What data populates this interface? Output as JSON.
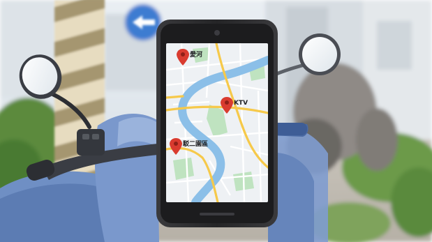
{
  "map": {
    "pins": [
      {
        "label": "愛河"
      },
      {
        "label": "KTV"
      },
      {
        "label": "駁二園區"
      }
    ]
  },
  "colors": {
    "sky": "#dfe7ee",
    "pole_stripe_light": "#e7dcc0",
    "pole_stripe_dark": "#9a8a62",
    "scooter_blue": "#6f8fc4",
    "phone_frame": "#2b2b2d",
    "map_background": "#eef1f4",
    "river": "#8bbfe8",
    "park": "#bfe3c0",
    "major_road": "#f6c94a",
    "pin": "#d93b2f"
  },
  "icons": [
    "map-pin-icon",
    "arrow-left-sign-icon",
    "front-camera-icon"
  ]
}
